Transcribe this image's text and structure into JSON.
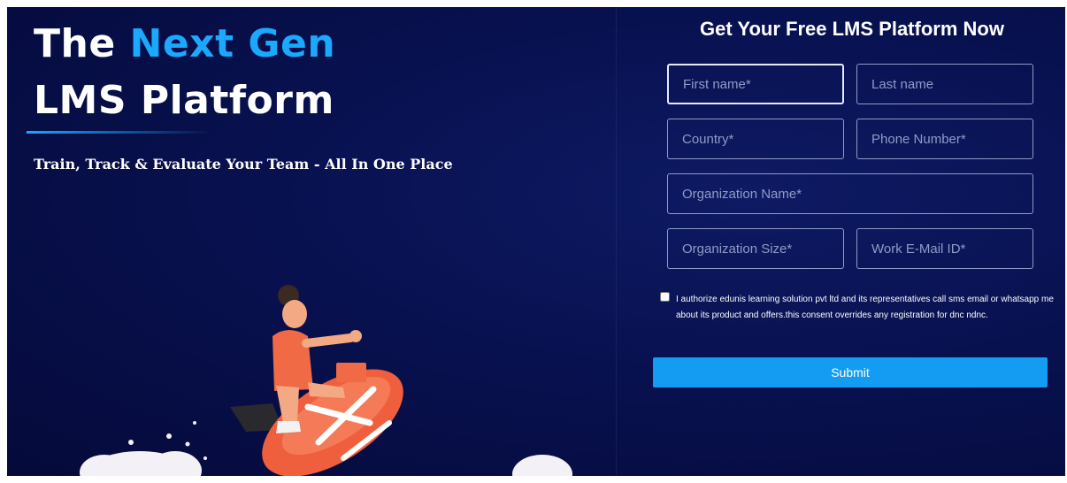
{
  "hero": {
    "title_line1_prefix": "The",
    "title_line1_accent": "Next Gen",
    "title_line2": "LMS Platform",
    "tagline": "Train, Track & Evaluate Your Team - All In One Place"
  },
  "form": {
    "title": "Get Your Free LMS Platform Now",
    "first_name_placeholder": "First name*",
    "last_name_placeholder": "Last name",
    "country_placeholder": "Country*",
    "phone_placeholder": "Phone Number*",
    "organization_name_placeholder": "Organization Name*",
    "organization_size_placeholder": "Organization Size*",
    "work_email_placeholder": "Work E-Mail ID*",
    "consent_text": "I authorize edunis learning solution pvt ltd and its representatives call sms email or whatsapp me about its product and offers.this consent overrides any registration for dnc ndnc.",
    "consent_checked": false,
    "submit_label": "Submit"
  },
  "colors": {
    "background": "#07104a",
    "accent": "#1aa9ff",
    "button": "#149cf3",
    "field_border": "#8f9bc7"
  }
}
